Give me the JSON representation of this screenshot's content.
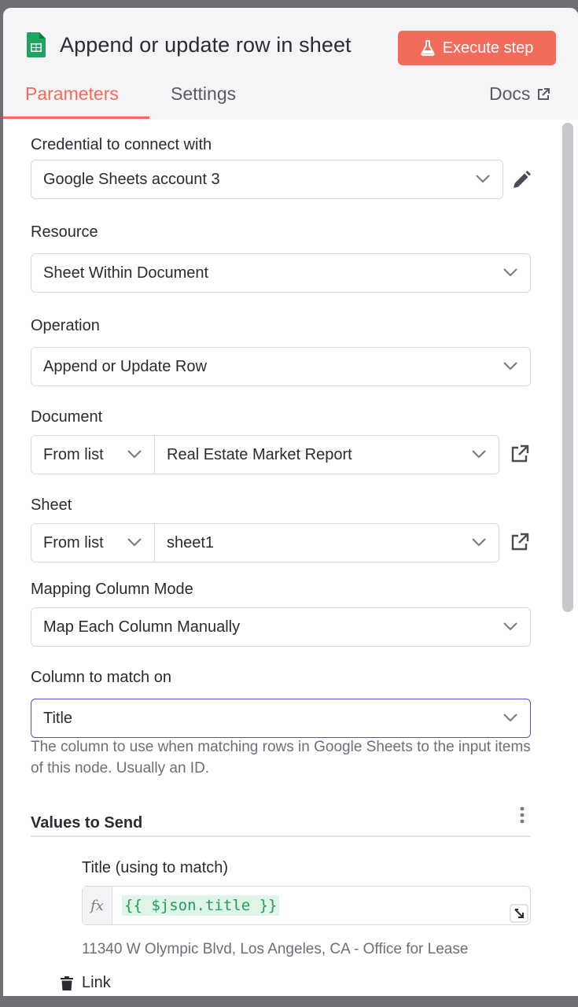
{
  "header": {
    "title": "Append or update row in sheet",
    "execute_label": "Execute step",
    "icons": {
      "app": "google-sheets-icon",
      "execute": "flask-icon"
    }
  },
  "tabs": [
    {
      "label": "Parameters",
      "active": true
    },
    {
      "label": "Settings",
      "active": false
    },
    {
      "label": "Docs",
      "active": false
    }
  ],
  "form": {
    "credential": {
      "label": "Credential to connect with",
      "value": "Google Sheets account 3"
    },
    "resource": {
      "label": "Resource",
      "value": "Sheet Within Document"
    },
    "operation": {
      "label": "Operation",
      "value": "Append or Update Row"
    },
    "document": {
      "label": "Document",
      "mode": "From list",
      "value": "Real Estate Market Report"
    },
    "sheet": {
      "label": "Sheet",
      "mode": "From list",
      "value": "sheet1"
    },
    "mapping_mode": {
      "label": "Mapping Column Mode",
      "value": "Map Each Column Manually"
    },
    "match_column": {
      "label": "Column to match on",
      "value": "Title",
      "hint": "The column to use when matching rows in Google Sheets to the input items of this node. Usually an ID."
    },
    "values_to_send": {
      "title": "Values to Send",
      "fields": [
        {
          "label": "Title (using to match)",
          "fx": "fx",
          "expression": "{{ $json.title }}",
          "preview": "11340 W Olympic Blvd, Los Angeles, CA - Office for Lease"
        },
        {
          "label": "Link"
        }
      ]
    }
  },
  "colors": {
    "accent": "#f26b5b",
    "focus_border": "#5b4ccc",
    "expression_bg": "#dff5e8",
    "expression_text": "#1f9d55",
    "sheets_green": "#1fa463"
  }
}
